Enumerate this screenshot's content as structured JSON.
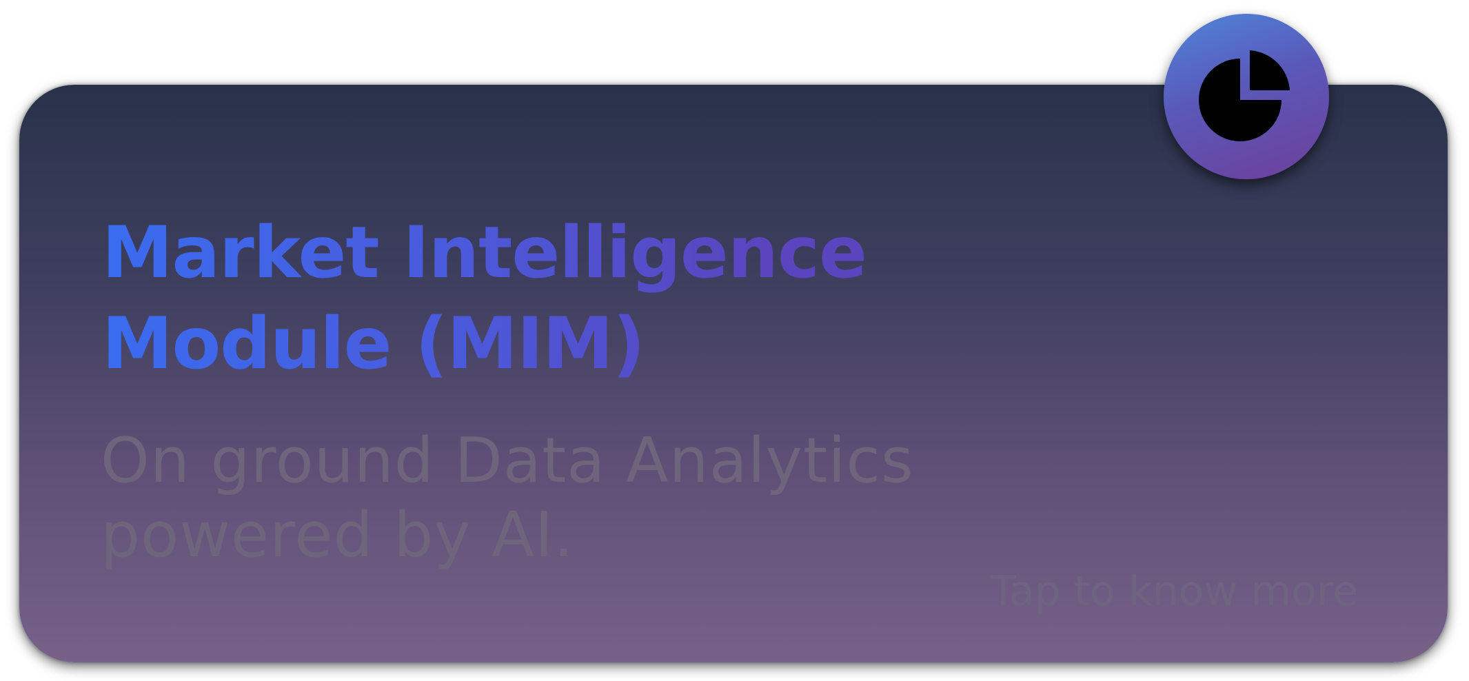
{
  "card": {
    "title_line1": "Market Intelligence",
    "title_line2": "Module (MIM)",
    "subtitle_line1": "On ground Data Analytics",
    "subtitle_line2": "powered by AI.",
    "cta_label": "Tap to know more"
  },
  "badge": {
    "icon": "pie-chart-icon"
  },
  "colors": {
    "title_gradient_start": "#3a6cf0",
    "title_gradient_end": "#5a45bf",
    "card_top": "#29324a",
    "card_bottom": "#776189",
    "subtitle": "#6e647c",
    "badge_start": "#4f86da",
    "badge_end": "#6e3f9a"
  }
}
